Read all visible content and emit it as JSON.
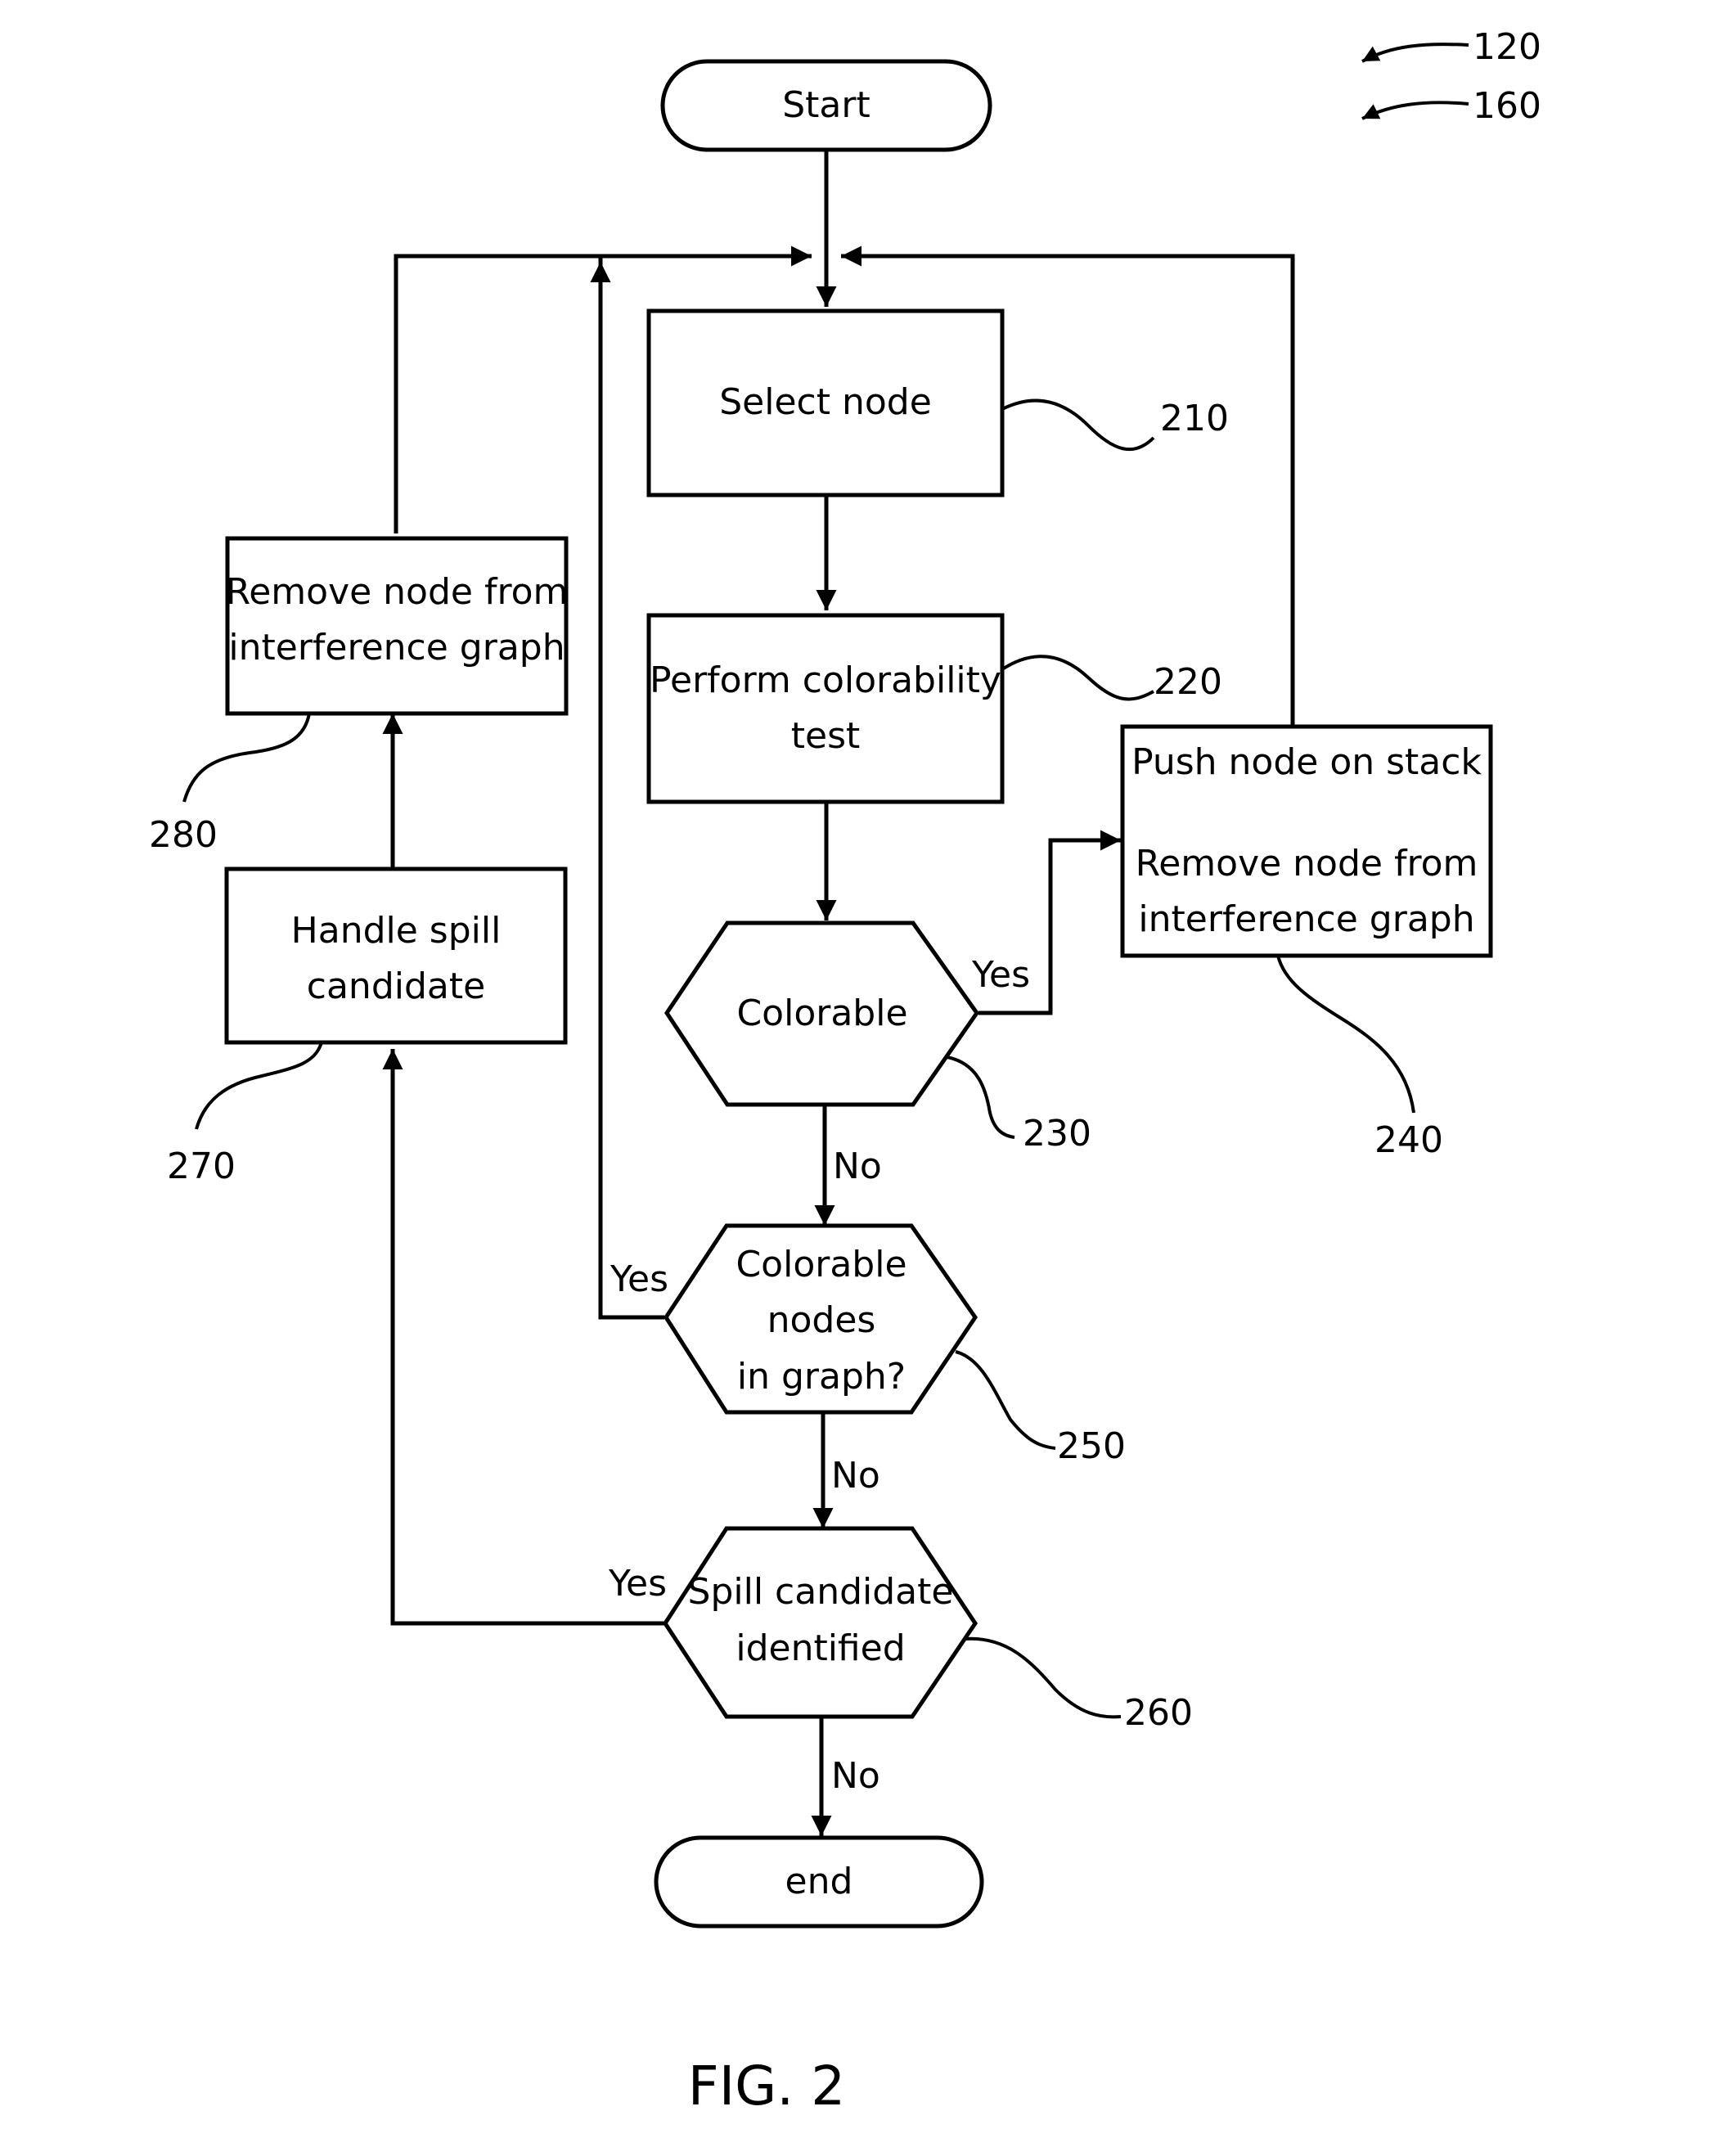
{
  "figure": {
    "caption": "FIG. 2",
    "reference_labels": [
      "120",
      "160"
    ]
  },
  "nodes": {
    "start": {
      "label": "Start"
    },
    "select_node": {
      "label": "Select node",
      "ref": "210"
    },
    "perform_test": {
      "lines": [
        "Perform colorability",
        "test"
      ],
      "ref": "220"
    },
    "colorable": {
      "label": "Colorable",
      "ref": "230"
    },
    "push_node": {
      "lines": [
        "Push node on stack",
        "Remove node from",
        "interference graph"
      ],
      "ref": "240"
    },
    "colorable_nodes": {
      "lines": [
        "Colorable",
        "nodes",
        "in graph?"
      ],
      "ref": "250"
    },
    "spill_candidate": {
      "lines": [
        "Spill candidate",
        "identified"
      ],
      "ref": "260"
    },
    "handle_spill": {
      "lines": [
        "Handle spill",
        "candidate"
      ],
      "ref": "270"
    },
    "remove_node": {
      "lines": [
        "Remove node from",
        "interference graph"
      ],
      "ref": "280"
    },
    "end": {
      "label": "end"
    }
  },
  "edges": {
    "colorable_yes": "Yes",
    "colorable_no": "No",
    "colorable_nodes_yes": "Yes",
    "colorable_nodes_no": "No",
    "spill_yes": "Yes",
    "spill_no": "No"
  }
}
